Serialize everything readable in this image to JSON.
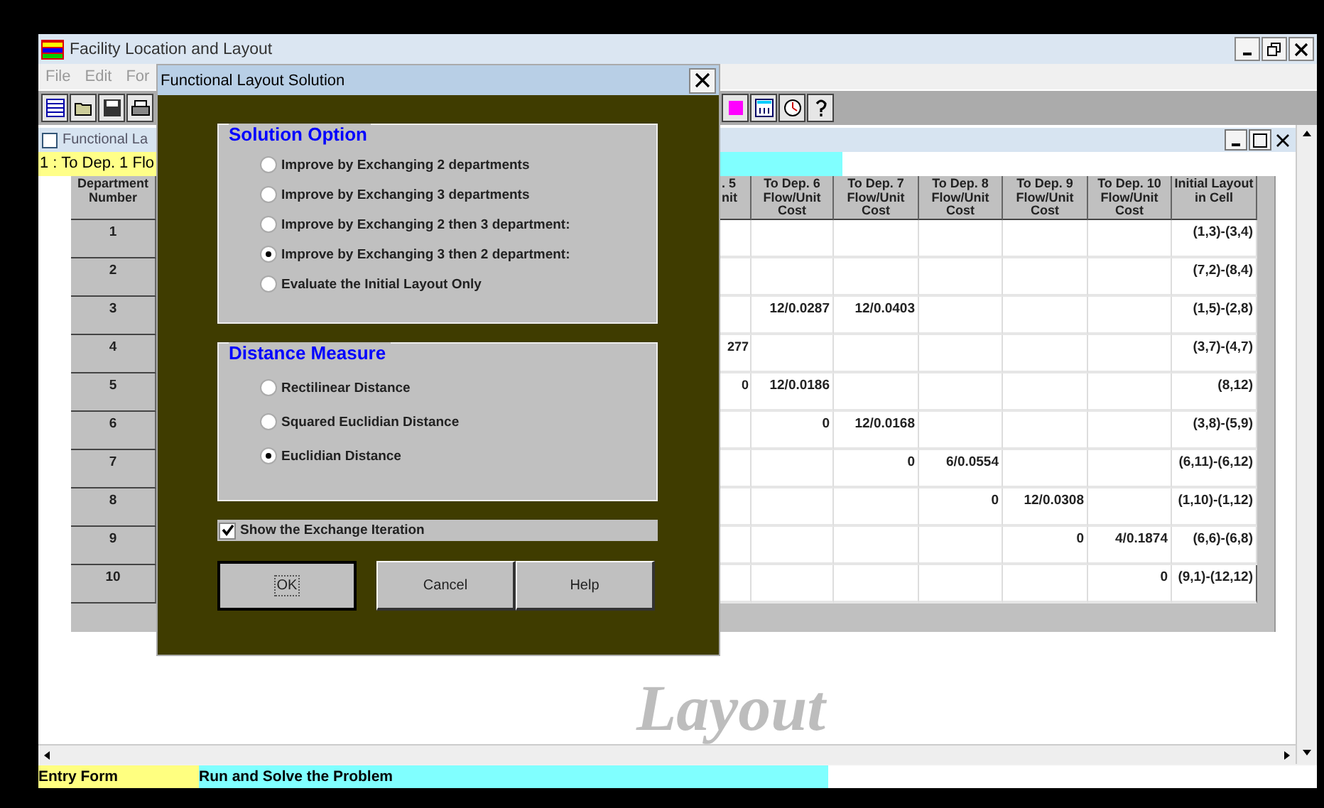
{
  "window": {
    "title": "Facility Location and Layout"
  },
  "menu": [
    "File",
    "Edit",
    "For"
  ],
  "child_window": {
    "title": "Functional La",
    "row_label": "1 : To Dep. 1 Flo"
  },
  "table": {
    "columns": [
      "Department Number",
      ". 5\nnit",
      "To Dep. 6 Flow/Unit Cost",
      "To Dep. 7 Flow/Unit Cost",
      "To Dep. 8 Flow/Unit Cost",
      "To Dep. 9 Flow/Unit Cost",
      "To Dep. 10 Flow/Unit Cost",
      "Initial Layout in Cell"
    ],
    "rows": [
      [
        "1",
        null,
        null,
        null,
        null,
        null,
        null,
        "(1,3)-(3,4)"
      ],
      [
        "2",
        null,
        null,
        null,
        null,
        null,
        null,
        "(7,2)-(8,4)"
      ],
      [
        "3",
        null,
        "12/0.0287",
        "12/0.0403",
        null,
        null,
        null,
        "(1,5)-(2,8)"
      ],
      [
        "4",
        "277",
        null,
        null,
        null,
        null,
        null,
        "(3,7)-(4,7)"
      ],
      [
        "5",
        "0",
        "12/0.0186",
        null,
        null,
        null,
        null,
        "(8,12)"
      ],
      [
        "6",
        null,
        "0",
        "12/0.0168",
        null,
        null,
        null,
        "(3,8)-(5,9)"
      ],
      [
        "7",
        null,
        null,
        "0",
        "6/0.0554",
        null,
        null,
        "(6,11)-(6,12)"
      ],
      [
        "8",
        null,
        null,
        null,
        "0",
        "12/0.0308",
        null,
        "(1,10)-(1,12)"
      ],
      [
        "9",
        null,
        null,
        null,
        null,
        "0",
        "4/0.1874",
        "(6,6)-(6,8)"
      ],
      [
        "10",
        null,
        null,
        null,
        null,
        null,
        "0",
        "(9,1)-(12,12)"
      ]
    ]
  },
  "background_text": "Layout",
  "status_bar": [
    "Entry Form",
    "Run and Solve the Problem"
  ],
  "dialog": {
    "title": "Functional Layout Solution",
    "solution_option": {
      "title": "Solution Option",
      "options": [
        {
          "label": "Improve by Exchanging 2 departments",
          "selected": false
        },
        {
          "label": "Improve by Exchanging 3 departments",
          "selected": false
        },
        {
          "label": "Improve by Exchanging 2 then 3 department:",
          "selected": false
        },
        {
          "label": "Improve by Exchanging 3 then 2 department:",
          "selected": true
        },
        {
          "label": "Evaluate the Initial Layout Only",
          "selected": false
        }
      ]
    },
    "distance_measure": {
      "title": "Distance Measure",
      "options": [
        {
          "label": "Rectilinear Distance",
          "selected": false
        },
        {
          "label": "Squared Euclidian Distance",
          "selected": false
        },
        {
          "label": "Euclidian Distance",
          "selected": true
        }
      ]
    },
    "show_iteration": {
      "label": "Show the Exchange Iteration",
      "checked": true
    },
    "buttons": [
      "OK",
      "Cancel",
      "Help"
    ]
  }
}
